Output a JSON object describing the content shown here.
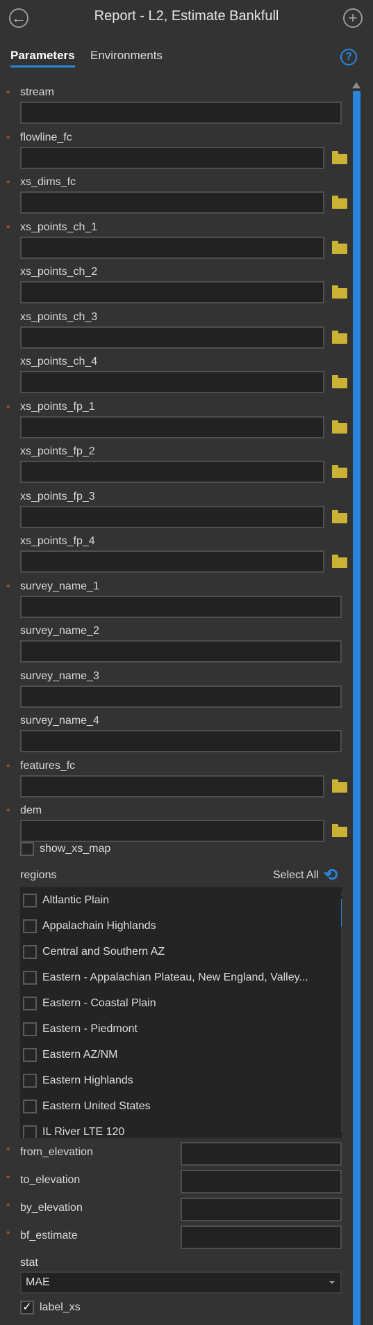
{
  "header": {
    "title": "Report - L2, Estimate Bankfull",
    "back_icon": "back-arrow-circle-icon",
    "add_icon": "plus-circle-icon"
  },
  "tabs": [
    {
      "label": "Parameters",
      "active": true
    },
    {
      "label": "Environments",
      "active": false
    }
  ],
  "help_label": "?",
  "fields": [
    {
      "label": "stream",
      "required": true,
      "browse": false,
      "value": ""
    },
    {
      "label": "flowline_fc",
      "required": true,
      "browse": true,
      "value": ""
    },
    {
      "label": "xs_dims_fc",
      "required": true,
      "browse": true,
      "value": ""
    },
    {
      "label": "xs_points_ch_1",
      "required": true,
      "browse": true,
      "value": ""
    },
    {
      "label": "xs_points_ch_2",
      "required": false,
      "browse": true,
      "value": ""
    },
    {
      "label": "xs_points_ch_3",
      "required": false,
      "browse": true,
      "value": ""
    },
    {
      "label": "xs_points_ch_4",
      "required": false,
      "browse": true,
      "value": ""
    },
    {
      "label": "xs_points_fp_1",
      "required": true,
      "browse": true,
      "value": ""
    },
    {
      "label": "xs_points_fp_2",
      "required": false,
      "browse": true,
      "value": ""
    },
    {
      "label": "xs_points_fp_3",
      "required": false,
      "browse": true,
      "value": ""
    },
    {
      "label": "xs_points_fp_4",
      "required": false,
      "browse": true,
      "value": ""
    },
    {
      "label": "survey_name_1",
      "required": true,
      "browse": false,
      "value": ""
    },
    {
      "label": "survey_name_2",
      "required": false,
      "browse": false,
      "value": ""
    },
    {
      "label": "survey_name_3",
      "required": false,
      "browse": false,
      "value": ""
    },
    {
      "label": "survey_name_4",
      "required": false,
      "browse": false,
      "value": ""
    },
    {
      "label": "features_fc",
      "required": true,
      "browse": true,
      "value": ""
    },
    {
      "label": "dem",
      "required": true,
      "browse": true,
      "value": ""
    }
  ],
  "required_mark": "*",
  "show_xs_map": {
    "label": "show_xs_map",
    "checked": false
  },
  "regions": {
    "label": "regions",
    "select_all": "Select All",
    "items": [
      {
        "label": "Altlantic Plain",
        "checked": false
      },
      {
        "label": "Appalachain Highlands",
        "checked": false
      },
      {
        "label": "Central and Southern AZ",
        "checked": false
      },
      {
        "label": "Eastern - Appalachian Plateau, New England, Valley...",
        "checked": false
      },
      {
        "label": "Eastern - Coastal Plain",
        "checked": false
      },
      {
        "label": "Eastern - Piedmont",
        "checked": false
      },
      {
        "label": "Eastern AZ/NM",
        "checked": false
      },
      {
        "label": "Eastern Highlands",
        "checked": false
      },
      {
        "label": "Eastern United States",
        "checked": false
      },
      {
        "label": "IL River LTE 120",
        "checked": false
      }
    ]
  },
  "numeric_fields": [
    {
      "label": "from_elevation",
      "required": true,
      "value": ""
    },
    {
      "label": "to_elevation",
      "required": true,
      "value": ""
    },
    {
      "label": "by_elevation",
      "required": true,
      "value": ""
    },
    {
      "label": "bf_estimate",
      "required": true,
      "value": ""
    }
  ],
  "stat": {
    "label": "stat",
    "value": "MAE"
  },
  "label_xs": {
    "label": "label_xs",
    "checked": true
  },
  "colors": {
    "accent": "#2a85dc",
    "required": "#d4592a",
    "folder": "#c9b234",
    "background": "#333333",
    "input": "#222222"
  }
}
